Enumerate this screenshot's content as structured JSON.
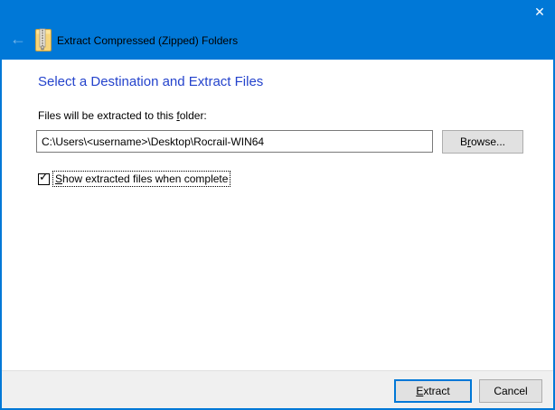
{
  "colors": {
    "accent": "#0078d7",
    "heading_blue": "#2443cc",
    "footer_bg": "#f0f0f0",
    "button_bg": "#e1e1e1",
    "button_border": "#adadad"
  },
  "icons": {
    "back": "←",
    "close": "✕",
    "check": "✓"
  },
  "window": {
    "title": "Extract Compressed (Zipped) Folders"
  },
  "main": {
    "heading": "Select a Destination and Extract Files",
    "folder_label": {
      "pre": "Files will be extracted to this ",
      "key": "f",
      "post": "older:"
    },
    "destination_path": "C:\\Users\\<username>\\Desktop\\Rocrail-WIN64",
    "browse_button": {
      "pre": "B",
      "key": "r",
      "post": "owse..."
    },
    "show_files_checkbox": {
      "checked": true,
      "label": {
        "pre": "",
        "key": "S",
        "post": "how extracted files when complete"
      }
    }
  },
  "footer": {
    "extract_button": {
      "pre": "",
      "key": "E",
      "post": "xtract"
    },
    "cancel_button": "Cancel"
  }
}
